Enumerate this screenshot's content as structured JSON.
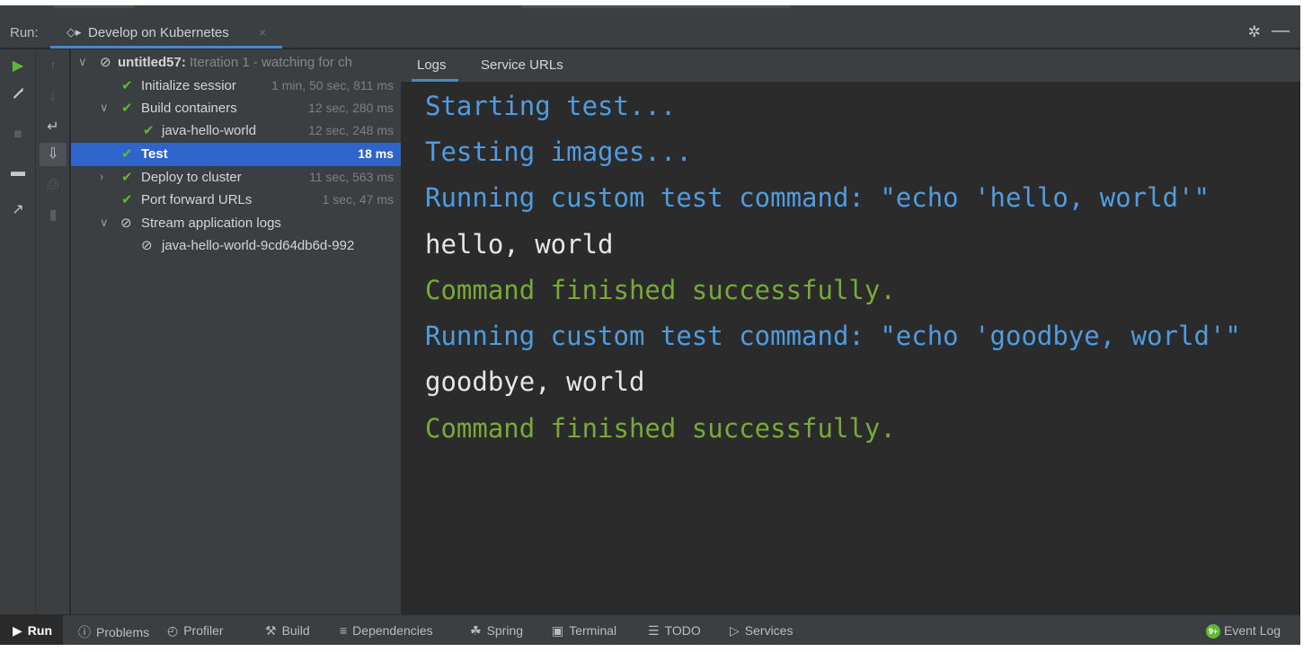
{
  "header": {
    "run_label": "Run:",
    "tab_title": "Develop on Kubernetes",
    "tab_close": "×",
    "gear": "✲",
    "minimize": "—"
  },
  "tree": {
    "root": {
      "label": "untitled57:",
      "suffix": "Iteration 1 - watching for ch"
    },
    "initialize": {
      "label": "Initialize sessior",
      "time": "1 min, 50 sec, 811 ms"
    },
    "build": {
      "label": "Build containers",
      "time": "12 sec, 280 ms"
    },
    "build_child": {
      "label": "java-hello-world",
      "time": "12 sec, 248 ms"
    },
    "test": {
      "label": "Test",
      "time": "18 ms"
    },
    "deploy": {
      "label": "Deploy to cluster",
      "time": "11 sec, 563 ms"
    },
    "port": {
      "label": "Port forward URLs",
      "time": "1 sec, 47 ms"
    },
    "stream": {
      "label": "Stream application logs"
    },
    "stream_child": {
      "label": "java-hello-world-9cd64db6d-992"
    }
  },
  "output_tabs": [
    "Logs",
    "Service URLs"
  ],
  "console": {
    "lines": [
      "Starting test...",
      "Testing images...",
      "Running custom test command: \"echo 'hello, world'\"",
      "hello, world",
      "Command finished successfully.",
      "Running custom test command: \"echo 'goodbye, world'\"",
      "goodbye, world",
      "Command finished successfully."
    ]
  },
  "statusbar": {
    "run": "Run",
    "problems": "Problems",
    "profiler": "Profiler",
    "build": "Build",
    "dependencies": "Dependencies",
    "spring": "Spring",
    "terminal": "Terminal",
    "todo": "TODO",
    "services": "Services",
    "event_log": "Event Log",
    "event_log_badge": "9+"
  },
  "colors": {
    "accent": "#4a88c7",
    "selection": "#2f65ca",
    "success": "#5fb832",
    "console_blue": "#4f9ce0",
    "console_green": "#79a938"
  }
}
